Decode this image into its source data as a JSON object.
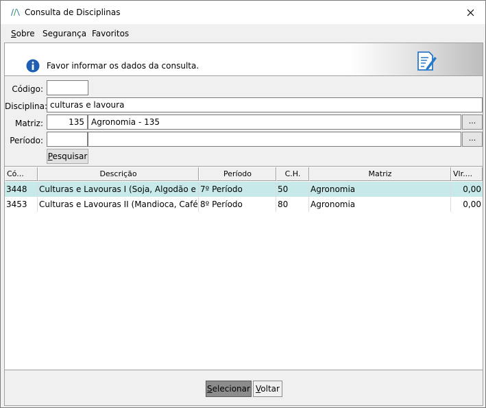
{
  "window": {
    "title": "Consulta de Disciplinas"
  },
  "menu": {
    "items": [
      {
        "label": "Sobre",
        "accel": "S",
        "rest": "obre"
      },
      {
        "label": "Segurança"
      },
      {
        "label": "Favoritos"
      }
    ]
  },
  "header": {
    "message": "Favor informar os dados da consulta."
  },
  "form": {
    "codigo": {
      "label": "Código:",
      "value": ""
    },
    "disciplina": {
      "label": "Disciplina:",
      "value": "culturas e lavoura"
    },
    "matriz": {
      "label": "Matriz:",
      "code": "135",
      "description": "Agronomia - 135"
    },
    "periodo": {
      "label": "Período:",
      "code": "",
      "description": ""
    },
    "lookup_label": "...",
    "search_button": {
      "label": "Pesquisar",
      "accel": "P",
      "rest": "esquisar"
    }
  },
  "grid": {
    "columns": [
      "Có...",
      "Descrição",
      "Período",
      "C.H.",
      "Matriz",
      "Vlr...."
    ],
    "rows": [
      {
        "codigo": "3448",
        "descricao": "Culturas e Lavouras I (Soja, Algodão e Mil...",
        "periodo": "7º Período",
        "ch": "50",
        "matriz": "Agronomia",
        "valor": "0,00",
        "selected": true
      },
      {
        "codigo": "3453",
        "descricao": "Culturas e Lavouras II (Mandioca, Café, Ca...",
        "periodo": "8º Período",
        "ch": "80",
        "matriz": "Agronomia",
        "valor": "0,00",
        "selected": false
      }
    ]
  },
  "footer": {
    "select_button": {
      "label": "Selecionar",
      "accel": "S",
      "rest": "elecionar"
    },
    "back_button": {
      "label": "Voltar",
      "accel": "V",
      "rest": "oltar"
    }
  },
  "colors": {
    "selected_row": "#c7e9e9",
    "info_icon": "#1e5fb4"
  }
}
